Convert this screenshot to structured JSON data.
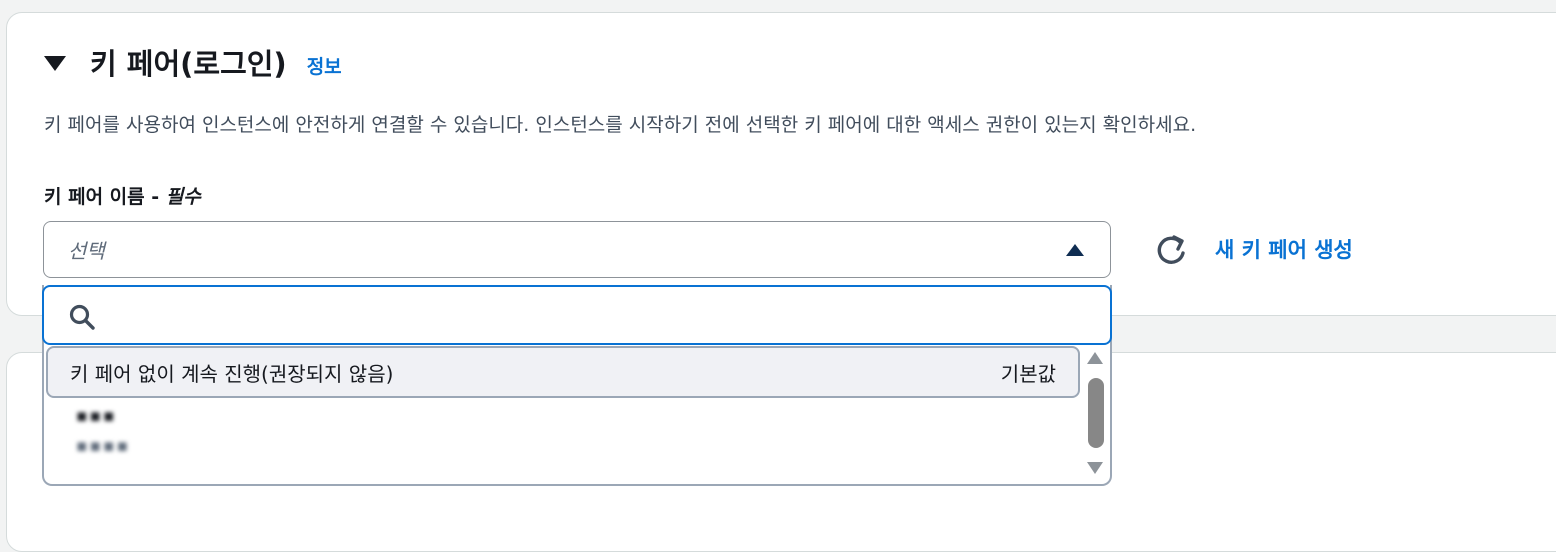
{
  "section": {
    "title": "키 페어(로그인)",
    "info_link": "정보",
    "description": "키 페어를 사용하여 인스턴스에 안전하게 연결할 수 있습니다. 인스턴스를 시작하기 전에 선택한 키 페어에 대한 액세스 권한이 있는지 확인하세요."
  },
  "field": {
    "label": "키 페어 이름 - ",
    "required": "필수",
    "placeholder": "선택",
    "create_link": "새 키 페어 생성"
  },
  "dropdown": {
    "search_value": "",
    "options": [
      {
        "label": "키 페어 없이 계속 진행(권장되지 않음)",
        "tag": "기본값"
      },
      {
        "label": "▪▪▪",
        "sublabel": "▪▪▪▪"
      }
    ]
  },
  "colors": {
    "link": "#0972d3",
    "focus_border": "#0972d3",
    "text": "#16191f"
  },
  "icons": {
    "section_toggle": "caret-down-icon",
    "select_caret": "caret-up-icon",
    "refresh": "refresh-icon",
    "search": "search-icon"
  }
}
